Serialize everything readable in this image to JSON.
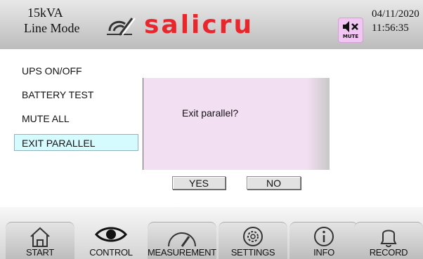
{
  "header": {
    "power_rating": "15kVA",
    "mode": "Line Mode",
    "brand": "salicru",
    "mute_label": "MUTE",
    "date": "04/11/2020",
    "time": "11:56:35",
    "brand_color": "#e8262b",
    "icons": [
      "network-disconnected-icon",
      "speaker-muted-icon"
    ]
  },
  "menu": {
    "items": [
      {
        "label": "UPS ON/OFF",
        "selected": false
      },
      {
        "label": "BATTERY TEST",
        "selected": false
      },
      {
        "label": "MUTE ALL",
        "selected": false
      },
      {
        "label": "EXIT PARALLEL",
        "selected": true
      }
    ]
  },
  "dialog": {
    "message": "Exit parallel?",
    "yes_label": "YES",
    "no_label": "NO"
  },
  "nav": {
    "active": "CONTROL",
    "tabs": [
      {
        "label": "START",
        "icon": "home-icon"
      },
      {
        "label": "CONTROL",
        "icon": "eye-icon"
      },
      {
        "label": "MEASUREMENTS",
        "icon": "gauge-icon"
      },
      {
        "label": "SETTINGS",
        "icon": "gear-icon"
      },
      {
        "label": "INFO",
        "icon": "info-icon"
      },
      {
        "label": "RECORD",
        "icon": "bell-icon"
      }
    ]
  }
}
